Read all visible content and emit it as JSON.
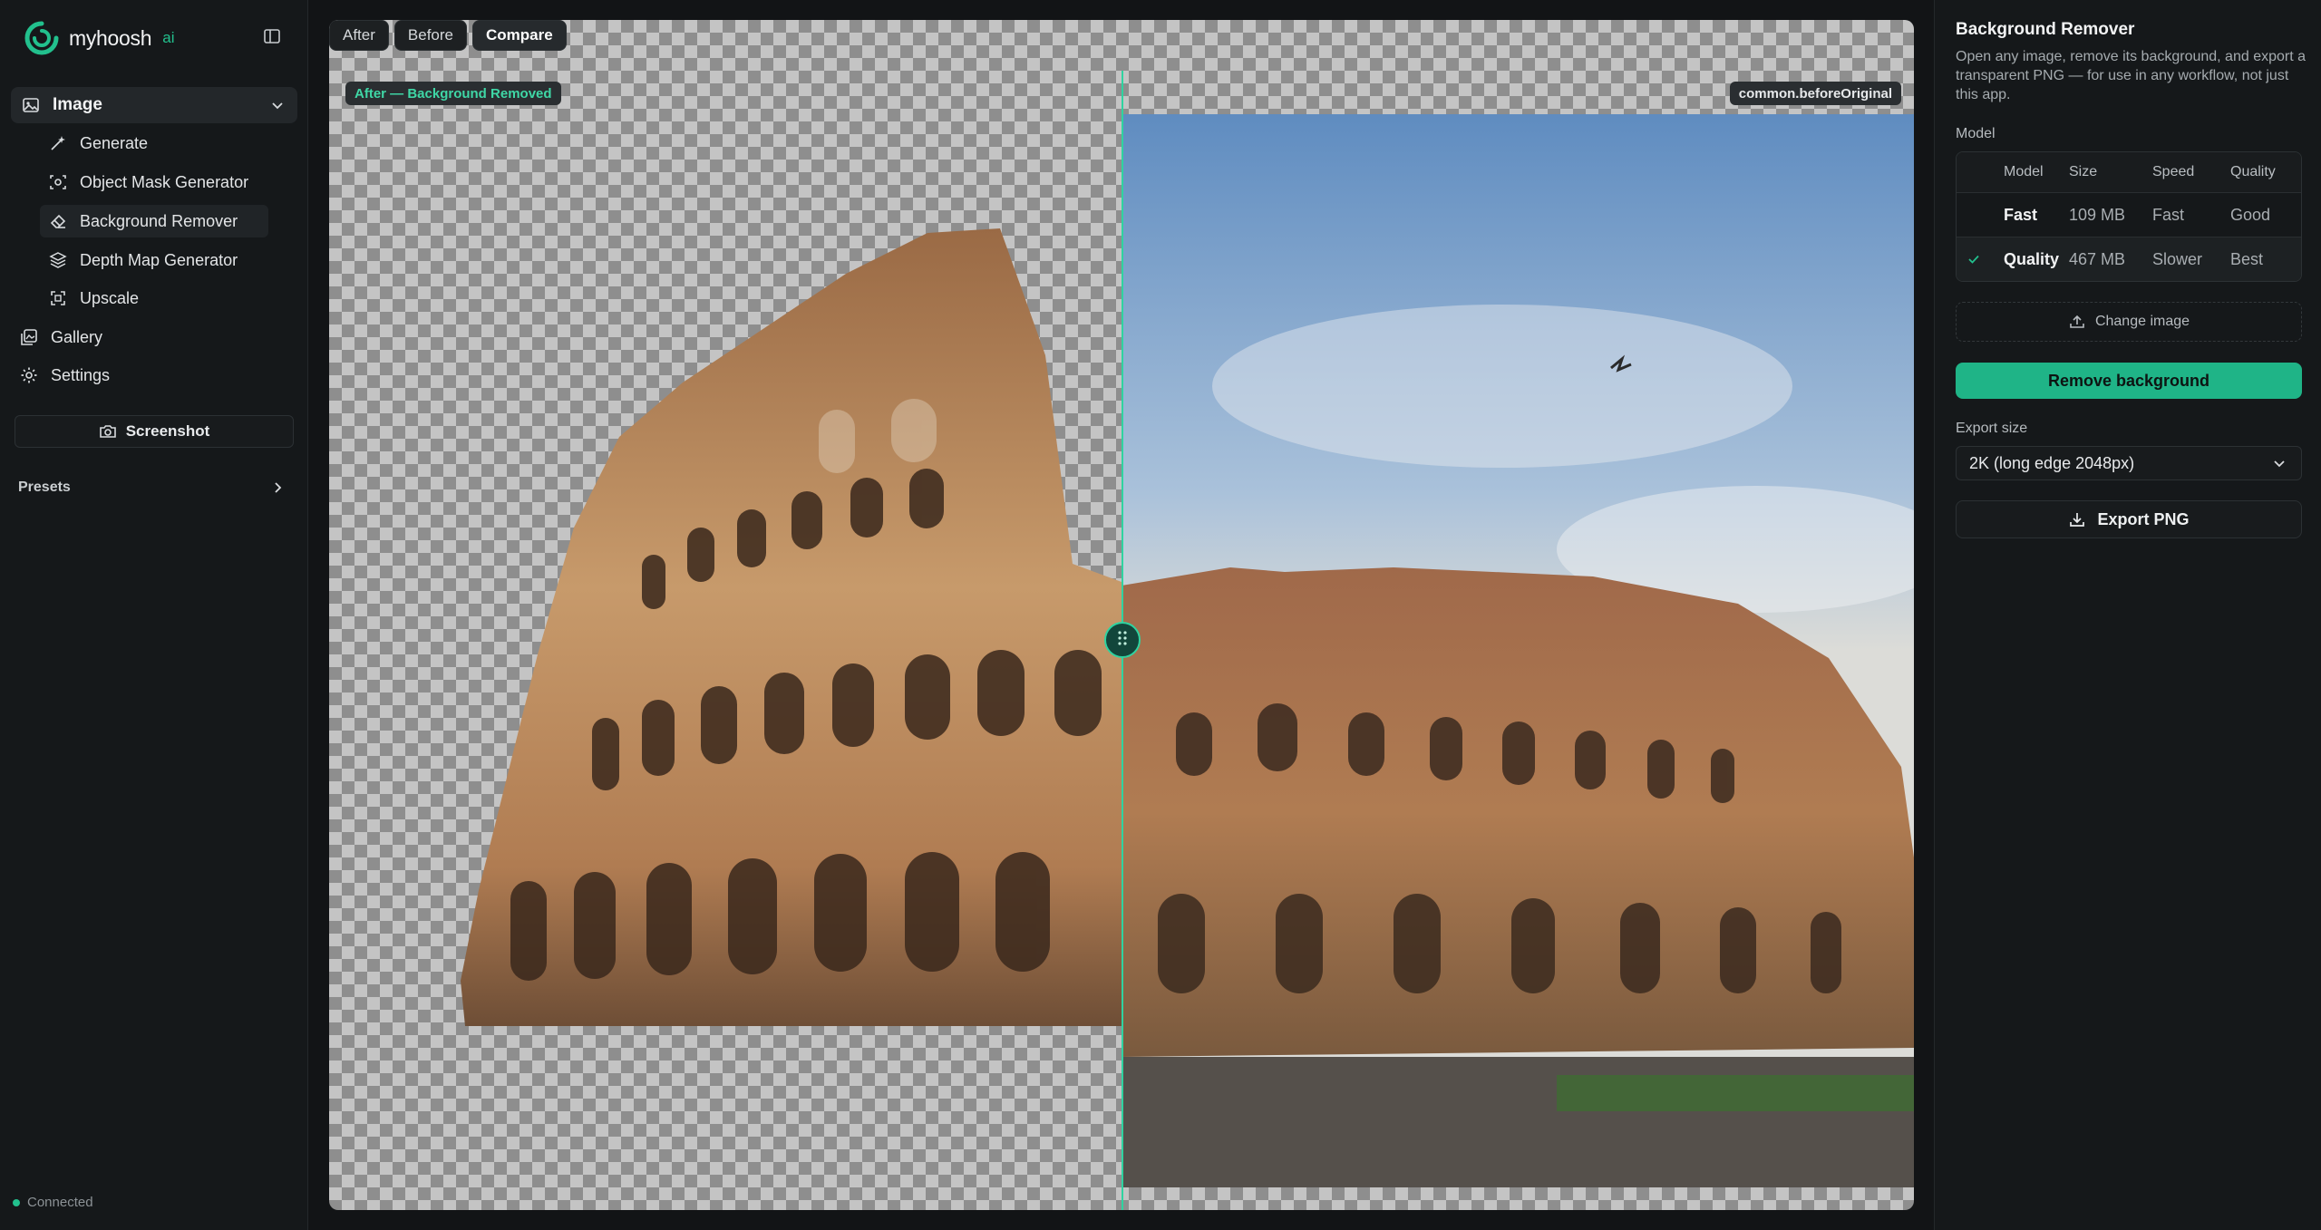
{
  "brand": {
    "name": "myhoosh",
    "suffix": "ai"
  },
  "sidebar": {
    "group": {
      "label": "Image",
      "icon": "image-icon"
    },
    "sub_items": [
      {
        "label": "Generate",
        "icon": "wand-icon"
      },
      {
        "label": "Object Mask Generator",
        "icon": "scan-icon"
      },
      {
        "label": "Background Remover",
        "icon": "eraser-icon",
        "active": true
      },
      {
        "label": "Depth Map Generator",
        "icon": "layers-icon"
      },
      {
        "label": "Upscale",
        "icon": "expand-icon"
      }
    ],
    "items": [
      {
        "label": "Gallery",
        "icon": "gallery-icon"
      },
      {
        "label": "Settings",
        "icon": "gear-icon"
      }
    ],
    "screenshot_label": "Screenshot",
    "presets_label": "Presets",
    "status": "Connected"
  },
  "canvas": {
    "view_modes": [
      "After",
      "Before",
      "Compare"
    ],
    "active_mode": "Compare",
    "after_label": "After — Background Removed",
    "before_label": "common.beforeOriginal",
    "split_position": 0.5
  },
  "panel": {
    "title": "Background Remover",
    "description": "Open any image, remove its background, and export a transparent PNG — for use in any workflow, not just this app.",
    "model_label": "Model",
    "model_table": {
      "headers": [
        "Model",
        "Size",
        "Speed",
        "Quality"
      ],
      "rows": [
        {
          "name": "Fast",
          "size": "109 MB",
          "speed": "Fast",
          "quality": "Good",
          "selected": false
        },
        {
          "name": "Quality",
          "size": "467 MB",
          "speed": "Slower",
          "quality": "Best",
          "selected": true
        }
      ]
    },
    "change_image_label": "Change image",
    "remove_bg_label": "Remove background",
    "export_size_label": "Export size",
    "export_size_value": "2K (long edge 2048px)",
    "export_png_label": "Export PNG"
  },
  "colors": {
    "accent": "#22c08d",
    "primary_button": "#1fb487",
    "after_label_text": "#3fd7a6"
  }
}
